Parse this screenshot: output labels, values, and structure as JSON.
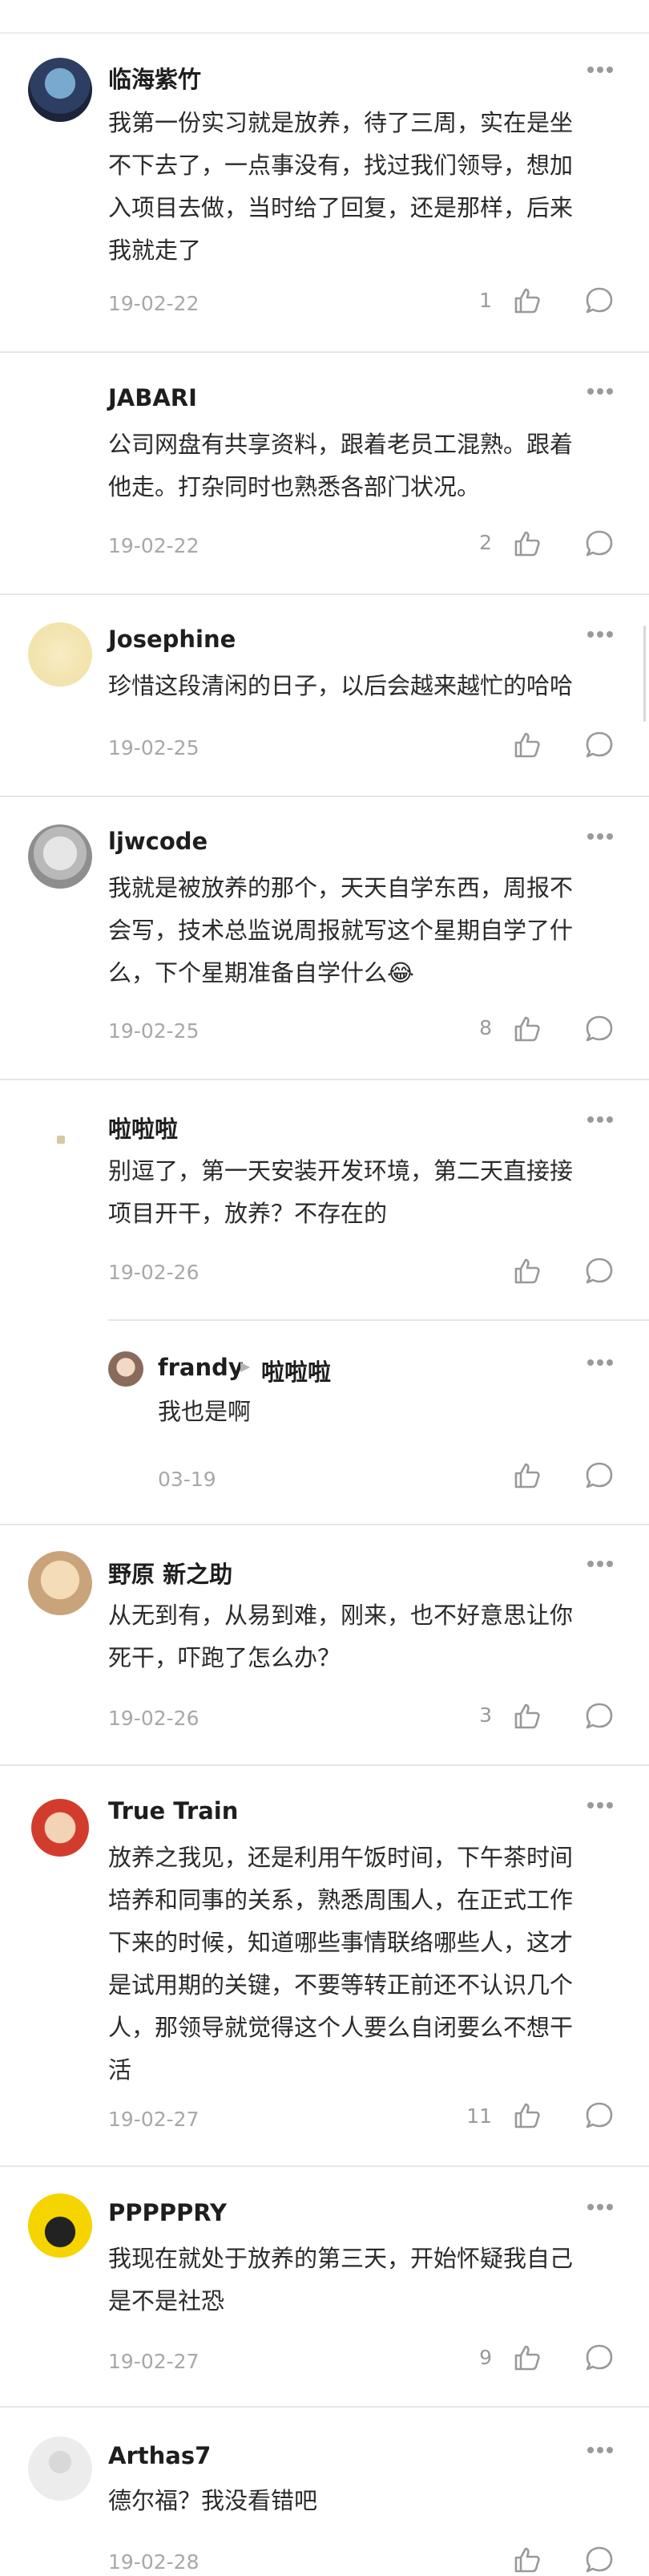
{
  "comments": [
    {
      "name": "临海紫竹",
      "text": "我第一份实习就是放养，待了三周，实在是坐不下去了，一点事没有，找过我们领导，想加入项目去做，当时给了回复，还是那样，后来我就走了",
      "lines": [
        "我第一份实习就是放养，待了三周，实在是坐",
        "不下去了，一点事没有，找过我们领导，想加",
        "入项目去做，当时给了回复，还是那样，后来",
        "我就走了"
      ],
      "date": "19-02-22",
      "likes": "1"
    },
    {
      "name": "JABARI",
      "lines": [
        "公司网盘有共享资料，跟着老员工混熟。跟着",
        "他走。打杂同时也熟悉各部门状况。"
      ],
      "date": "19-02-22",
      "likes": "2"
    },
    {
      "name": "Josephine",
      "lines": [
        "珍惜这段清闲的日子，以后会越来越忙的哈哈"
      ],
      "date": "19-02-25",
      "likes": ""
    },
    {
      "name": "ljwcode",
      "lines": [
        "我就是被放养的那个，天天自学东西，周报不",
        "会写，技术总监说周报就写这个星期自学了什",
        "么，下个星期准备自学什么😂"
      ],
      "date": "19-02-25",
      "likes": "8"
    },
    {
      "name": "啦啦啦",
      "lines": [
        "别逗了，第一天安装开发环境，第二天直接接",
        "项目开干，放养？不存在的"
      ],
      "date": "19-02-26",
      "likes": "",
      "reply": {
        "name": "frandy",
        "to": "啦啦啦",
        "text": "我也是啊",
        "date": "03-19",
        "likes": ""
      }
    },
    {
      "name": "野原 新之助",
      "lines": [
        "从无到有，从易到难，刚来，也不好意思让你",
        "死干，吓跑了怎么办？"
      ],
      "date": "19-02-26",
      "likes": "3"
    },
    {
      "name": "True Train",
      "lines": [
        "放养之我见，还是利用午饭时间，下午茶时间",
        "培养和同事的关系，熟悉周围人，在正式工作",
        "下来的时候，知道哪些事情联络哪些人，这才",
        "是试用期的关键，不要等转正前还不认识几个",
        "人，那领导就觉得这个人要么自闭要么不想干",
        "活"
      ],
      "date": "19-02-27",
      "likes": "11"
    },
    {
      "name": "PPPPPRY",
      "lines": [
        "我现在就处于放养的第三天，开始怀疑我自己",
        "是不是社恐"
      ],
      "date": "19-02-27",
      "likes": "9"
    },
    {
      "name": "Arthas7",
      "lines": [
        "德尔福？我没看错吧"
      ],
      "date": "19-02-28",
      "likes": ""
    }
  ],
  "colors": {
    "divider": "#e6e6e6",
    "meta": "#a8a8a8",
    "icon": "#9a9a9a"
  },
  "icons": {
    "like": "thumbs-up-icon",
    "reply": "comment-bubble-icon",
    "more": "more-dots-icon"
  }
}
